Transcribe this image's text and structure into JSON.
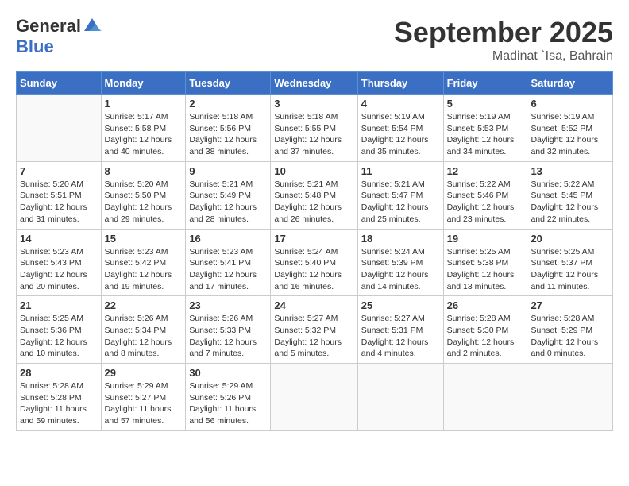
{
  "logo": {
    "general": "General",
    "blue": "Blue"
  },
  "title": "September 2025",
  "location": "Madinat `Isa, Bahrain",
  "days_of_week": [
    "Sunday",
    "Monday",
    "Tuesday",
    "Wednesday",
    "Thursday",
    "Friday",
    "Saturday"
  ],
  "weeks": [
    [
      {
        "day": "",
        "info": ""
      },
      {
        "day": "1",
        "info": "Sunrise: 5:17 AM\nSunset: 5:58 PM\nDaylight: 12 hours\nand 40 minutes."
      },
      {
        "day": "2",
        "info": "Sunrise: 5:18 AM\nSunset: 5:56 PM\nDaylight: 12 hours\nand 38 minutes."
      },
      {
        "day": "3",
        "info": "Sunrise: 5:18 AM\nSunset: 5:55 PM\nDaylight: 12 hours\nand 37 minutes."
      },
      {
        "day": "4",
        "info": "Sunrise: 5:19 AM\nSunset: 5:54 PM\nDaylight: 12 hours\nand 35 minutes."
      },
      {
        "day": "5",
        "info": "Sunrise: 5:19 AM\nSunset: 5:53 PM\nDaylight: 12 hours\nand 34 minutes."
      },
      {
        "day": "6",
        "info": "Sunrise: 5:19 AM\nSunset: 5:52 PM\nDaylight: 12 hours\nand 32 minutes."
      }
    ],
    [
      {
        "day": "7",
        "info": "Sunrise: 5:20 AM\nSunset: 5:51 PM\nDaylight: 12 hours\nand 31 minutes."
      },
      {
        "day": "8",
        "info": "Sunrise: 5:20 AM\nSunset: 5:50 PM\nDaylight: 12 hours\nand 29 minutes."
      },
      {
        "day": "9",
        "info": "Sunrise: 5:21 AM\nSunset: 5:49 PM\nDaylight: 12 hours\nand 28 minutes."
      },
      {
        "day": "10",
        "info": "Sunrise: 5:21 AM\nSunset: 5:48 PM\nDaylight: 12 hours\nand 26 minutes."
      },
      {
        "day": "11",
        "info": "Sunrise: 5:21 AM\nSunset: 5:47 PM\nDaylight: 12 hours\nand 25 minutes."
      },
      {
        "day": "12",
        "info": "Sunrise: 5:22 AM\nSunset: 5:46 PM\nDaylight: 12 hours\nand 23 minutes."
      },
      {
        "day": "13",
        "info": "Sunrise: 5:22 AM\nSunset: 5:45 PM\nDaylight: 12 hours\nand 22 minutes."
      }
    ],
    [
      {
        "day": "14",
        "info": "Sunrise: 5:23 AM\nSunset: 5:43 PM\nDaylight: 12 hours\nand 20 minutes."
      },
      {
        "day": "15",
        "info": "Sunrise: 5:23 AM\nSunset: 5:42 PM\nDaylight: 12 hours\nand 19 minutes."
      },
      {
        "day": "16",
        "info": "Sunrise: 5:23 AM\nSunset: 5:41 PM\nDaylight: 12 hours\nand 17 minutes."
      },
      {
        "day": "17",
        "info": "Sunrise: 5:24 AM\nSunset: 5:40 PM\nDaylight: 12 hours\nand 16 minutes."
      },
      {
        "day": "18",
        "info": "Sunrise: 5:24 AM\nSunset: 5:39 PM\nDaylight: 12 hours\nand 14 minutes."
      },
      {
        "day": "19",
        "info": "Sunrise: 5:25 AM\nSunset: 5:38 PM\nDaylight: 12 hours\nand 13 minutes."
      },
      {
        "day": "20",
        "info": "Sunrise: 5:25 AM\nSunset: 5:37 PM\nDaylight: 12 hours\nand 11 minutes."
      }
    ],
    [
      {
        "day": "21",
        "info": "Sunrise: 5:25 AM\nSunset: 5:36 PM\nDaylight: 12 hours\nand 10 minutes."
      },
      {
        "day": "22",
        "info": "Sunrise: 5:26 AM\nSunset: 5:34 PM\nDaylight: 12 hours\nand 8 minutes."
      },
      {
        "day": "23",
        "info": "Sunrise: 5:26 AM\nSunset: 5:33 PM\nDaylight: 12 hours\nand 7 minutes."
      },
      {
        "day": "24",
        "info": "Sunrise: 5:27 AM\nSunset: 5:32 PM\nDaylight: 12 hours\nand 5 minutes."
      },
      {
        "day": "25",
        "info": "Sunrise: 5:27 AM\nSunset: 5:31 PM\nDaylight: 12 hours\nand 4 minutes."
      },
      {
        "day": "26",
        "info": "Sunrise: 5:28 AM\nSunset: 5:30 PM\nDaylight: 12 hours\nand 2 minutes."
      },
      {
        "day": "27",
        "info": "Sunrise: 5:28 AM\nSunset: 5:29 PM\nDaylight: 12 hours\nand 0 minutes."
      }
    ],
    [
      {
        "day": "28",
        "info": "Sunrise: 5:28 AM\nSunset: 5:28 PM\nDaylight: 11 hours\nand 59 minutes."
      },
      {
        "day": "29",
        "info": "Sunrise: 5:29 AM\nSunset: 5:27 PM\nDaylight: 11 hours\nand 57 minutes."
      },
      {
        "day": "30",
        "info": "Sunrise: 5:29 AM\nSunset: 5:26 PM\nDaylight: 11 hours\nand 56 minutes."
      },
      {
        "day": "",
        "info": ""
      },
      {
        "day": "",
        "info": ""
      },
      {
        "day": "",
        "info": ""
      },
      {
        "day": "",
        "info": ""
      }
    ]
  ]
}
